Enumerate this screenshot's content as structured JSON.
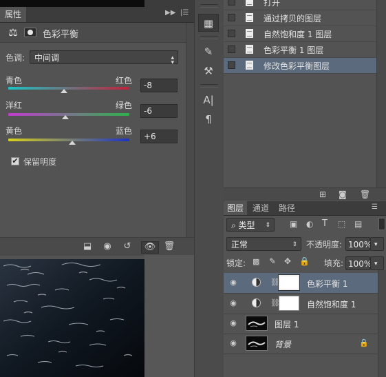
{
  "properties": {
    "tab": "属性",
    "title": "色彩平衡",
    "tone_label": "色调:",
    "tone_value": "中间调",
    "sliders": [
      {
        "left": "青色",
        "right": "红色",
        "value": "-8",
        "level": -8,
        "gradient": "#19c4c4,#c2213a"
      },
      {
        "left": "洋红",
        "right": "绿色",
        "value": "-6",
        "level": -6,
        "gradient": "#c23bd0,#2db34a"
      },
      {
        "left": "黄色",
        "right": "蓝色",
        "value": "+6",
        "level": 6,
        "gradient": "#d8d21b,#1c32c7"
      }
    ],
    "preserve_luminosity": "保留明度",
    "preserve_checked": true
  },
  "history": {
    "items": [
      {
        "label": "打开",
        "selected": false
      },
      {
        "label": "通过拷贝的图层",
        "selected": false
      },
      {
        "label": "自然饱和度 1 图层",
        "selected": false
      },
      {
        "label": "色彩平衡 1 图层",
        "selected": false
      },
      {
        "label": "修改色彩平衡图层",
        "selected": true
      }
    ]
  },
  "layers": {
    "tabs": [
      "图层",
      "通道",
      "路径"
    ],
    "filter_type": "类型",
    "blend_mode": "正常",
    "opacity_label": "不透明度:",
    "opacity_value": "100%",
    "lock_label": "锁定:",
    "fill_label": "填充:",
    "fill_value": "100%",
    "items": [
      {
        "name": "色彩平衡 1",
        "kind": "adjustment",
        "selected": true,
        "italic": false
      },
      {
        "name": "自然饱和度 1",
        "kind": "adjustment",
        "selected": false,
        "italic": false
      },
      {
        "name": "图层 1",
        "kind": "pixel",
        "selected": false,
        "italic": false
      },
      {
        "name": "背景",
        "kind": "background",
        "selected": false,
        "italic": true
      }
    ]
  },
  "colors": {
    "panel_bg": "#535353",
    "selection": "#5b6a7c"
  }
}
